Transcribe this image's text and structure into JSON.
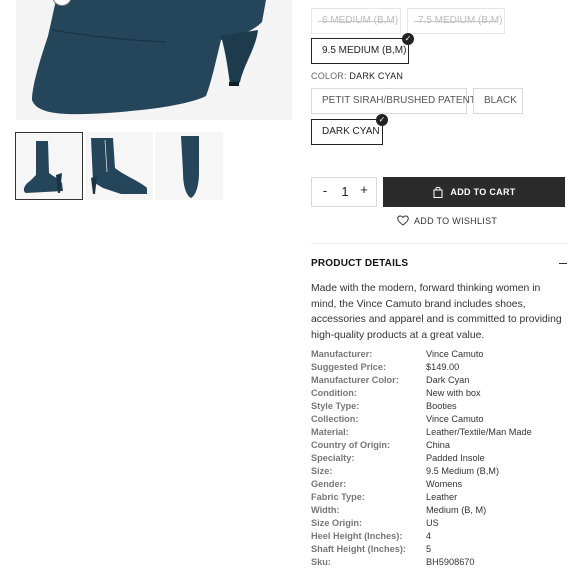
{
  "product": {
    "size_options": [
      {
        "label": "6 MEDIUM (B,M)",
        "state": "disabled"
      },
      {
        "label": "7.5 MEDIUM (B,M)",
        "state": "disabled"
      },
      {
        "label": "9.5 MEDIUM (B,M)",
        "state": "selected"
      }
    ],
    "color": {
      "label": "COLOR:",
      "value": "DARK CYAN",
      "options": [
        {
          "label": "PETIT SIRAH/BRUSHED PATENT",
          "state": "default"
        },
        {
          "label": "BLACK",
          "state": "default"
        },
        {
          "label": "DARK CYAN",
          "state": "selected"
        }
      ]
    },
    "boot_color": "#25455a",
    "quantity": {
      "minus": "-",
      "value": "1",
      "plus": "+"
    },
    "cart_button": {
      "label": "ADD TO CART",
      "icon": "shopping-bag-icon"
    },
    "wishlist": {
      "label": "ADD TO WISHLIST",
      "icon": "heart-icon"
    },
    "details": {
      "heading": "PRODUCT DETAILS",
      "description": "Made with the modern, forward thinking women in mind, the Vince Camuto brand includes shoes, accessories and apparel and is committed to providing high-quality products at a great value.",
      "specs": [
        {
          "key": "Manufacturer:",
          "value": "Vince Camuto"
        },
        {
          "key": "Suggested Price:",
          "value": "$149.00"
        },
        {
          "key": "Manufacturer Color:",
          "value": "Dark Cyan"
        },
        {
          "key": "Condition:",
          "value": "New with box"
        },
        {
          "key": "Style Type:",
          "value": "Booties"
        },
        {
          "key": "Collection:",
          "value": "Vince Camuto"
        },
        {
          "key": "Material:",
          "value": "Leather/Textile/Man Made"
        },
        {
          "key": "Country of Origin:",
          "value": "China"
        },
        {
          "key": "Specialty:",
          "value": "Padded Insole"
        },
        {
          "key": "Size:",
          "value": "9.5 Medium (B,M)"
        },
        {
          "key": "Gender:",
          "value": "Womens"
        },
        {
          "key": "Fabric Type:",
          "value": "Leather"
        },
        {
          "key": "Width:",
          "value": "Medium (B, M)"
        },
        {
          "key": "Size Origin:",
          "value": "US"
        },
        {
          "key": "Heel Height (Inches):",
          "value": "4"
        },
        {
          "key": "Shaft Height (Inches):",
          "value": "5"
        },
        {
          "key": "Sku:",
          "value": "BH5908670"
        }
      ]
    }
  }
}
